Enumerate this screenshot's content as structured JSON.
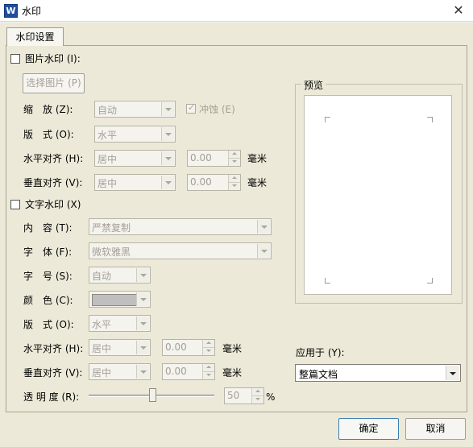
{
  "window": {
    "title": "水印",
    "app_icon_text": "W",
    "close_glyph": "✕"
  },
  "tabs": [
    {
      "label": "水印设置"
    }
  ],
  "picture": {
    "checkbox_label": "图片水印 (I):",
    "select_button": "选择图片 (P)",
    "scale": {
      "label": "缩　放 (Z):",
      "value": "自动"
    },
    "washout": {
      "label": "冲蚀 (E)",
      "mark": "✓"
    },
    "layout": {
      "label": "版　式 (O):",
      "value": "水平"
    },
    "halign": {
      "label": "水平对齐 (H):",
      "value": "居中",
      "offset": "0.00",
      "unit": "毫米"
    },
    "valign": {
      "label": "垂直对齐 (V):",
      "value": "居中",
      "offset": "0.00",
      "unit": "毫米"
    }
  },
  "text": {
    "checkbox_label": "文字水印 (X)",
    "content": {
      "label": "内　容 (T):",
      "value": "严禁复制"
    },
    "font": {
      "label": "字　体 (F):",
      "value": "微软雅黑"
    },
    "size": {
      "label": "字　号 (S):",
      "value": "自动"
    },
    "color": {
      "label": "颜　色 (C):",
      "swatch": "#bfbfbf"
    },
    "layout": {
      "label": "版　式 (O):",
      "value": "水平"
    },
    "halign": {
      "label": "水平对齐 (H):",
      "value": "居中",
      "offset": "0.00",
      "unit": "毫米"
    },
    "valign": {
      "label": "垂直对齐 (V):",
      "value": "居中",
      "offset": "0.00",
      "unit": "毫米"
    },
    "transparency": {
      "label": "透 明 度 (R):",
      "value": "50",
      "unit": "%",
      "slider_fraction": 0.5
    }
  },
  "preview": {
    "label": "预览"
  },
  "apply": {
    "label": "应用于 (Y):",
    "value": "整篇文档"
  },
  "buttons": {
    "ok": "确定",
    "cancel": "取消"
  },
  "colors": {
    "accent": "#3c7fb1",
    "dialog_bg": "#ece9d8",
    "disabled_text": "#a4a096"
  }
}
